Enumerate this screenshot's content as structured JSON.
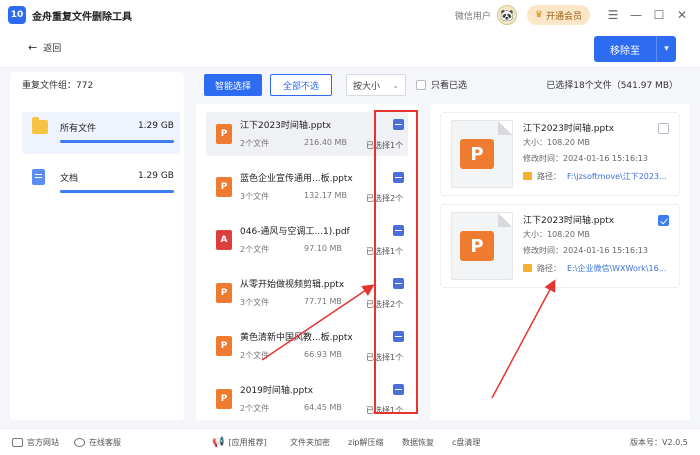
{
  "app": {
    "logo_text": "10",
    "title": "金舟重复文件删除工具",
    "user_name": "微信用户",
    "vip_label": "开通会员"
  },
  "header": {
    "back_label": "返回",
    "move_label": "移除至"
  },
  "sidebar": {
    "group_count": "重复文件组：772",
    "categories": [
      {
        "name": "所有文件",
        "size": "1.29 GB",
        "icon": "folder-icon",
        "active": true
      },
      {
        "name": "文档",
        "size": "1.29 GB",
        "icon": "document-icon",
        "active": false
      }
    ]
  },
  "toolbar": {
    "smart_select": "智能选择",
    "deselect_all": "全部不选",
    "sort_label": "按大小",
    "only_selected": "只看已选",
    "selected_summary": "已选择18个文件（541.97 MB）"
  },
  "files": [
    {
      "name": "江下2023时间轴.pptx",
      "count": "2个文件",
      "size": "216.40 MB",
      "selected": "已选择1个",
      "type": "ppt",
      "active": true
    },
    {
      "name": "蓝色企业宣传通用...板.pptx",
      "count": "3个文件",
      "size": "132.17 MB",
      "selected": "已选择2个",
      "type": "ppt",
      "active": false
    },
    {
      "name": "046-通风与空调工...1).pdf",
      "count": "2个文件",
      "size": "97.10 MB",
      "selected": "已选择1个",
      "type": "pdf",
      "active": false
    },
    {
      "name": "从零开始做视频剪辑.pptx",
      "count": "3个文件",
      "size": "77.71 MB",
      "selected": "已选择2个",
      "type": "ppt",
      "active": false
    },
    {
      "name": "黄色清新中国风教...板.pptx",
      "count": "2个文件",
      "size": "66.93 MB",
      "selected": "已选择1个",
      "type": "ppt",
      "active": false
    },
    {
      "name": "2019时间轴.pptx",
      "count": "2个文件",
      "size": "64.45 MB",
      "selected": "已选择1个",
      "type": "ppt",
      "active": false
    }
  ],
  "details": [
    {
      "name": "江下2023时间轴.pptx",
      "size": "大小：108.20 MB",
      "modified": "修改时间：2024-01-16 15:16:13",
      "path_label": "路径：",
      "path": "F:\\jzsoftmove\\江下2023...",
      "checked": false
    },
    {
      "name": "江下2023时间轴.pptx",
      "size": "大小：108.20 MB",
      "modified": "修改时间：2024-01-16 15:16:13",
      "path_label": "路径：",
      "path": "E:\\企业微信\\WXWork\\16...",
      "checked": true
    }
  ],
  "statusbar": {
    "website": "官方网站",
    "support": "在线客服",
    "recommend": "[应用推荐]",
    "links": [
      "文件夹加密",
      "zip解压缩",
      "数据恢复",
      "c盘清理"
    ],
    "version": "版本号：V2.0.5"
  },
  "colors": {
    "primary": "#2d6cf0",
    "annotation": "#e3342f",
    "ppt": "#ee7b2f",
    "pdf": "#dd3e3e"
  }
}
